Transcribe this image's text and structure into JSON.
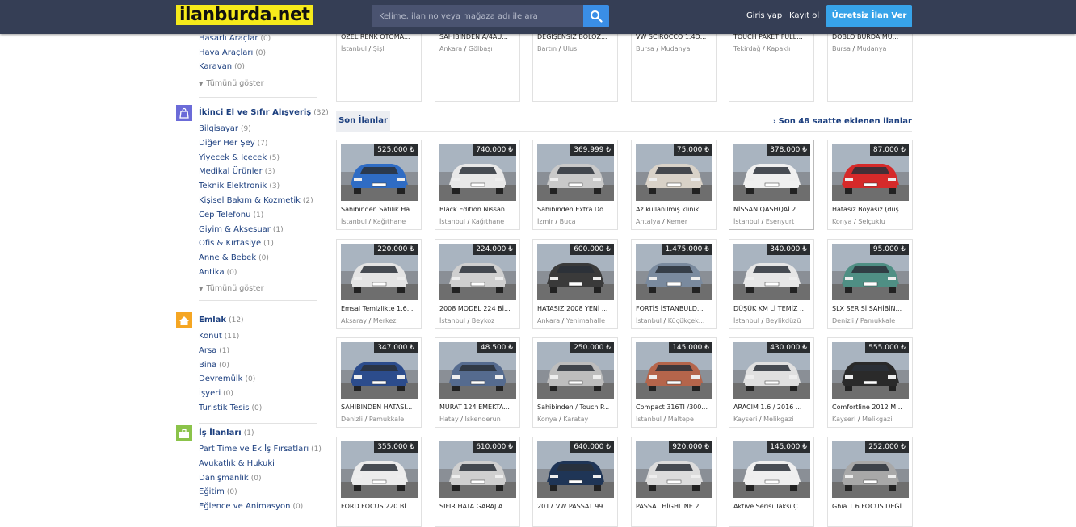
{
  "header": {
    "logo": "ilanburda.net",
    "search_placeholder": "Kelime, ilan no veya mağaza adı ile ara",
    "login": "Giriş yap",
    "register": "Kayıt ol",
    "free_ad": "Ücretsiz İlan Ver"
  },
  "sidebar": {
    "top_items": [
      {
        "label": "Hasarlı Araçlar",
        "count": "(0)"
      },
      {
        "label": "Hava Araçları",
        "count": "(0)"
      },
      {
        "label": "Karavan",
        "count": "(0)"
      }
    ],
    "show_all": "Tümünü göster",
    "categories": [
      {
        "title": "İkinci El ve Sıfır Alışveriş",
        "count": "(32)",
        "icon": "shopping-bag-icon",
        "color": "#6b6bd8",
        "items": [
          {
            "label": "Bilgisayar",
            "count": "(9)"
          },
          {
            "label": "Diğer Her Şey",
            "count": "(7)"
          },
          {
            "label": "Yiyecek & İçecek",
            "count": "(5)"
          },
          {
            "label": "Medikal Ürünler",
            "count": "(3)"
          },
          {
            "label": "Teknik Elektronik",
            "count": "(3)"
          },
          {
            "label": "Kişisel Bakım & Kozmetik",
            "count": "(2)"
          },
          {
            "label": "Cep Telefonu",
            "count": "(1)"
          },
          {
            "label": "Giyim & Aksesuar",
            "count": "(1)"
          },
          {
            "label": "Ofis & Kırtasiye",
            "count": "(1)"
          },
          {
            "label": "Anne & Bebek",
            "count": "(0)"
          },
          {
            "label": "Antika",
            "count": "(0)"
          }
        ]
      },
      {
        "title": "Emlak",
        "count": "(12)",
        "icon": "home-icon",
        "color": "#f5a623",
        "items": [
          {
            "label": "Konut",
            "count": "(11)"
          },
          {
            "label": "Arsa",
            "count": "(1)"
          },
          {
            "label": "Bina",
            "count": "(0)"
          },
          {
            "label": "Devremülk",
            "count": "(0)"
          },
          {
            "label": "İşyeri",
            "count": "(0)"
          },
          {
            "label": "Turistik Tesis",
            "count": "(0)"
          }
        ]
      },
      {
        "title": "İş İlanları",
        "count": "(1)",
        "icon": "briefcase-icon",
        "color": "#8bc34a",
        "items": [
          {
            "label": "Part Time ve Ek İş Fırsatları",
            "count": "(1)"
          },
          {
            "label": "Avukatlık & Hukuki",
            "count": ""
          },
          {
            "label": "Danışmanlık",
            "count": "(0)"
          },
          {
            "label": "Eğitim",
            "count": "(0)"
          },
          {
            "label": "Eğlence ve Animasyon",
            "count": "(0)"
          }
        ]
      }
    ]
  },
  "showcase": [
    {
      "title": "ÖZEL RENK OTOMA...",
      "city": "İstanbul",
      "district": "Şişli",
      "color": "#d8382b"
    },
    {
      "title": "SAHİBİNDEN A/4AU...",
      "city": "Ankara",
      "district": "Gölbaşı",
      "color": "#dcdcdc"
    },
    {
      "title": "DEĞİŞENSİZ BOLÖZ...",
      "city": "Bartın",
      "district": "Ulus",
      "color": "#2b2b2e"
    },
    {
      "title": "VW SCIROCCO 1.4D...",
      "city": "Bursa",
      "district": "Mudanya",
      "color": "#2a6fd1"
    },
    {
      "title": "TOUCH PAKET FULL...",
      "city": "Tekirdağ",
      "district": "Kapaklı",
      "color": "#f2f2f2"
    },
    {
      "title": "DOBLO BURDA MU...",
      "city": "Bursa",
      "district": "Mudanya",
      "color": "#3b3b3b"
    }
  ],
  "section": {
    "tab": "Son İlanlar",
    "link": "Son 48 saatte eklenen ilanlar"
  },
  "listings": [
    {
      "price": "525.000 ₺",
      "title": "Sahibinden Satılık Ha...",
      "city": "İstanbul",
      "district": "Kağıthane",
      "color": "#2f6cc4"
    },
    {
      "price": "740.000 ₺",
      "title": "Black Edition Nissan ...",
      "city": "İstanbul",
      "district": "Kağıthane",
      "color": "#e8e8e8"
    },
    {
      "price": "369.999 ₺",
      "title": "Sahibinden Extra Do...",
      "city": "İzmir",
      "district": "Buca",
      "color": "#c9c9c9"
    },
    {
      "price": "75.000 ₺",
      "title": "Az kullanılmış klinik ...",
      "city": "Antalya",
      "district": "Kemer",
      "color": "#d9d2c8"
    },
    {
      "price": "378.000 ₺",
      "title": "NİSSAN QASHQAİ 2...",
      "city": "İstanbul",
      "district": "Esenyurt",
      "color": "#f0f0f0"
    },
    {
      "price": "87.000 ₺",
      "title": "Hatasız Boyasız (düş...",
      "city": "Konya",
      "district": "Selçuklu",
      "color": "#d62a2a"
    },
    {
      "price": "220.000 ₺",
      "title": "Emsal Temizlikte 1.6...",
      "city": "Aksaray",
      "district": "Merkez",
      "color": "#e4e4e4"
    },
    {
      "price": "224.000 ₺",
      "title": "2008 MODEL 224 Bİ...",
      "city": "İstanbul",
      "district": "Beykoz",
      "color": "#cfcfcf"
    },
    {
      "price": "600.000 ₺",
      "title": "HATASIZ 2008 YENİ ...",
      "city": "Ankara",
      "district": "Yenimahalle",
      "color": "#3a3a3a"
    },
    {
      "price": "1.475.000 ₺",
      "title": "FORTİS İSTANBULD...",
      "city": "İstanbul",
      "district": "Küçükçek...",
      "color": "#7a8a9e"
    },
    {
      "price": "340.000 ₺",
      "title": "DÜŞÜK KM Lİ TEMİZ ...",
      "city": "İstanbul",
      "district": "Beylikdüzü",
      "color": "#e6e6e6"
    },
    {
      "price": "95.000 ₺",
      "title": "SLX SERİSİ SAHİBİN...",
      "city": "Denizli",
      "district": "Pamukkale",
      "color": "#4f8f84"
    },
    {
      "price": "347.000 ₺",
      "title": "SAHİBİNDEN HATASI...",
      "city": "Denizli",
      "district": "Pamukkale",
      "color": "#2c4c8c"
    },
    {
      "price": "48.500 ₺",
      "title": "MURAT 124 EMEKTA...",
      "city": "Hatay",
      "district": "İskenderun",
      "color": "#556b8f"
    },
    {
      "price": "250.000 ₺",
      "title": "Sahibinden / Touch P...",
      "city": "Konya",
      "district": "Karatay",
      "color": "#bdbdbd"
    },
    {
      "price": "145.000 ₺",
      "title": "Compact 316Tİ /300...",
      "city": "İstanbul",
      "district": "Maltepe",
      "color": "#b5654b"
    },
    {
      "price": "430.000 ₺",
      "title": "ARACIM 1.6 / 2016 ...",
      "city": "Kayseri",
      "district": "Melikgazi",
      "color": "#e0e0e0"
    },
    {
      "price": "555.000 ₺",
      "title": "Comfortline 2012 M...",
      "city": "Kayseri",
      "district": "Melikgazi",
      "color": "#2a2a2a"
    },
    {
      "price": "355.000 ₺",
      "title": "FORD FOCUS 220 Bİ...",
      "city": "",
      "district": "",
      "color": "#ececec"
    },
    {
      "price": "610.000 ₺",
      "title": "SIFIR HATA GARAJ A...",
      "city": "",
      "district": "",
      "color": "#cfcfcf"
    },
    {
      "price": "640.000 ₺",
      "title": "2017 VW PASSAT 99...",
      "city": "",
      "district": "",
      "color": "#1f3556"
    },
    {
      "price": "920.000 ₺",
      "title": "PASSAT HİGHLİNE 2...",
      "city": "",
      "district": "",
      "color": "#dcdcdc"
    },
    {
      "price": "145.000 ₺",
      "title": "Aktive Serisi Taksi Ç...",
      "city": "",
      "district": "",
      "color": "#efefef"
    },
    {
      "price": "252.000 ₺",
      "title": "Ghia 1.6 FOCUS DEĞİ...",
      "city": "",
      "district": "",
      "color": "#a8a8a8"
    }
  ]
}
